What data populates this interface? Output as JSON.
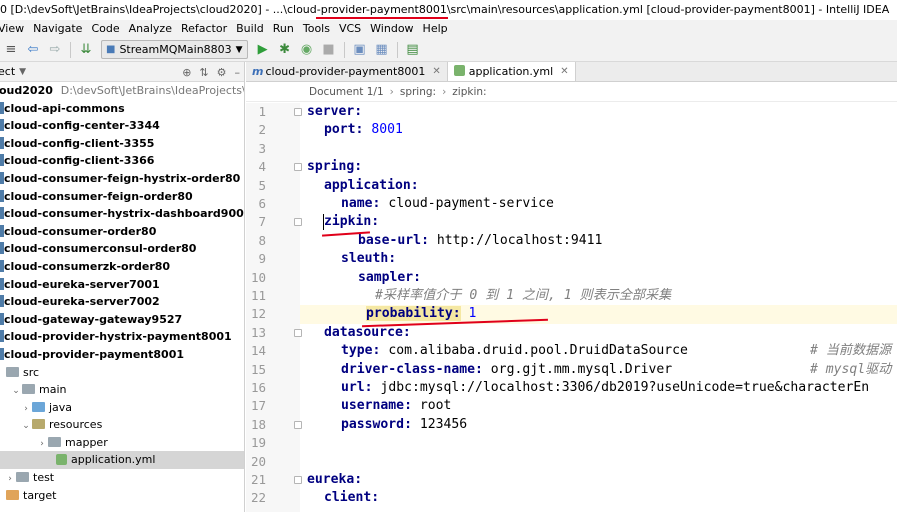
{
  "window": {
    "title": "0 [D:\\devSoft\\JetBrains\\IdeaProjects\\cloud2020] - ...\\cloud-provider-payment8001\\src\\main\\resources\\application.yml [cloud-provider-payment8001] - IntelliJ IDEA"
  },
  "menubar": {
    "items": [
      "View",
      "Navigate",
      "Code",
      "Analyze",
      "Refactor",
      "Build",
      "Run",
      "Tools",
      "VCS",
      "Window",
      "Help"
    ]
  },
  "toolbar": {
    "run_config": "StreamMQMain8803"
  },
  "project": {
    "header_label": "ect",
    "root_name": "oud2020",
    "root_path": "D:\\devSoft\\JetBrains\\IdeaProjects\\cloud20",
    "modules": [
      "cloud-api-commons",
      "cloud-config-center-3344",
      "cloud-config-client-3355",
      "cloud-config-client-3366",
      "cloud-consumer-feign-hystrix-order80",
      "cloud-consumer-feign-order80",
      "cloud-consumer-hystrix-dashboard9001",
      "cloud-consumer-order80",
      "cloud-consumerconsul-order80",
      "cloud-consumerzk-order80",
      "cloud-eureka-server7001",
      "cloud-eureka-server7002",
      "cloud-gateway-gateway9527",
      "cloud-provider-hystrix-payment8001",
      "cloud-provider-payment8001"
    ],
    "sub_tree": {
      "src": "src",
      "main": "main",
      "java": "java",
      "resources": "resources",
      "mapper": "mapper",
      "application_file": "application.yml",
      "test": "test",
      "target": "target"
    }
  },
  "editor": {
    "tabs": [
      {
        "label": "cloud-provider-payment8001",
        "icon": "m"
      },
      {
        "label": "application.yml",
        "icon": "yml"
      }
    ],
    "breadcrumb": [
      "Document 1/1",
      "spring:",
      "zipkin:"
    ],
    "line_numbers": [
      "1",
      "2",
      "3",
      "4",
      "5",
      "6",
      "7",
      "8",
      "9",
      "10",
      "11",
      "12",
      "13",
      "14",
      "15",
      "16",
      "17",
      "18",
      "19",
      "20",
      "21",
      "22"
    ],
    "code": {
      "l1_key": "server:",
      "l2_key": "port:",
      "l2_val": "8001",
      "l4_key": "spring:",
      "l5_key": "application:",
      "l6_key": "name:",
      "l6_val": "cloud-payment-service",
      "l7_key": "zipkin:",
      "l8_key": "base-url:",
      "l8_val": "http://localhost:9411",
      "l9_key": "sleuth:",
      "l10_key": "sampler:",
      "l11_comment": "#采样率值介于 0 到 1 之间, 1 则表示全部采集",
      "l12_key": "probability:",
      "l12_val": "1",
      "l13_key": "datasource:",
      "l14_key": "type:",
      "l14_val": "com.alibaba.druid.pool.DruidDataSource",
      "l14_comment": "# 当前数据源",
      "l15_key": "driver-class-name:",
      "l15_val": "org.gjt.mm.mysql.Driver",
      "l15_comment": "# mysql驱动",
      "l16_key": "url:",
      "l16_val": "jdbc:mysql://localhost:3306/db2019?useUnicode=true&characterEn",
      "l17_key": "username:",
      "l17_val": "root",
      "l18_key": "password:",
      "l18_val": "123456",
      "l21_key": "eureka:",
      "l22_key": "client:"
    }
  },
  "colors": {
    "annotation_red": "#e0001a",
    "yaml_key": "#000080",
    "number": "#0000ff"
  }
}
